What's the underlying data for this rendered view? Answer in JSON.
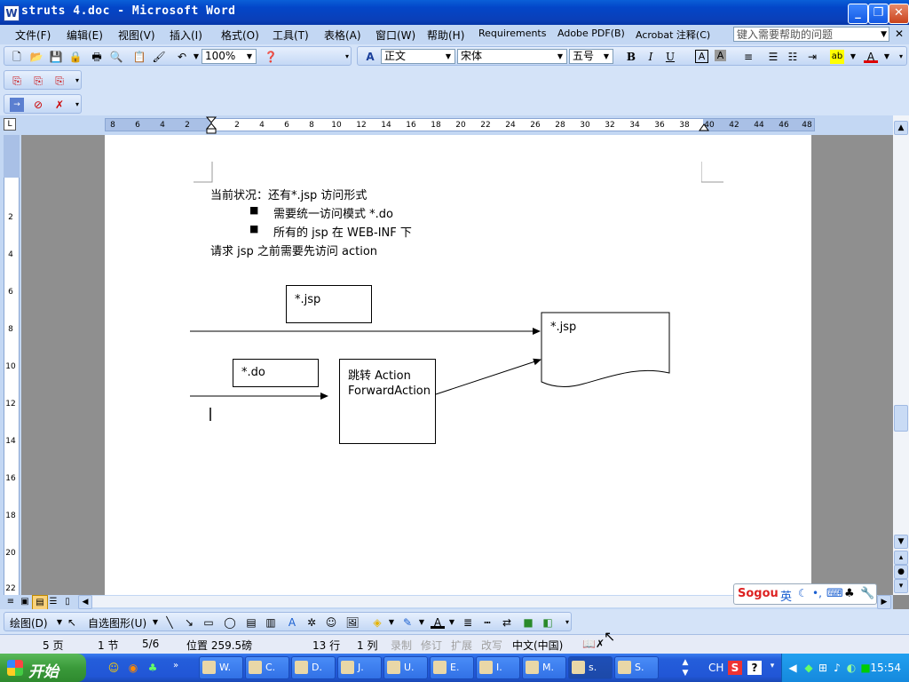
{
  "window": {
    "title": "struts 4.doc - Microsoft Word",
    "app_icon": "W"
  },
  "menu": {
    "items": [
      "文件(F)",
      "编辑(E)",
      "视图(V)",
      "插入(I)",
      "格式(O)",
      "工具(T)",
      "表格(A)",
      "窗口(W)",
      "帮助(H)",
      "Requirements",
      "Adobe PDF(B)",
      "Acrobat 注释(C)"
    ],
    "help_placeholder": "键入需要帮助的问题"
  },
  "toolbar": {
    "zoom": "100%",
    "style": "正文",
    "font": "宋体",
    "size": "五号",
    "bold": "B",
    "italic": "I",
    "underline": "U",
    "char_border": "A",
    "char_shade": "A"
  },
  "ruler": {
    "ticks": [
      "8",
      "6",
      "4",
      "2",
      "2",
      "4",
      "6",
      "8",
      "10",
      "12",
      "14",
      "16",
      "18",
      "20",
      "22",
      "24",
      "26",
      "28",
      "30",
      "32",
      "34",
      "36",
      "38",
      "40",
      "42",
      "44",
      "46",
      "48"
    ],
    "vticks": [
      "2",
      "4",
      "6",
      "8",
      "10",
      "12",
      "14",
      "16",
      "18",
      "20",
      "22"
    ]
  },
  "document": {
    "line1": "当前状况：还有*.jsp 访问形式",
    "bullet1": "需要统一访问模式  *.do",
    "bullet2": "所有的 jsp 在 WEB-INF 下",
    "line2": "请求 jsp 之前需要先访问 action",
    "bullet_glyph": "■",
    "diagram": {
      "box_jsp": "*.jsp",
      "box_do": "*.do",
      "box_action_line1": "跳转 Action",
      "box_action_line2": "ForwardAction",
      "doc_shape": "*.jsp"
    }
  },
  "drawing_toolbar": {
    "draw": "绘图(D)",
    "autoshapes": "自选图形(U)"
  },
  "status": {
    "page": "5 页",
    "section": "1 节",
    "pages": "5/6",
    "position": "位置 259.5磅",
    "line": "13 行",
    "col": "1 列",
    "rec": "录制",
    "trk": "修订",
    "ext": "扩展",
    "ovr": "改写",
    "lang": "中文(中国)"
  },
  "ime": {
    "brand": "Sogou",
    "mode": "英"
  },
  "taskbar": {
    "start": "开始",
    "tasks": [
      "W.",
      "C.",
      "D.",
      "J.",
      "U.",
      "E.",
      "I.",
      "M.",
      "s.",
      "S."
    ],
    "active_task": "s.",
    "tray_lang": "CH",
    "clock": "15:54"
  }
}
